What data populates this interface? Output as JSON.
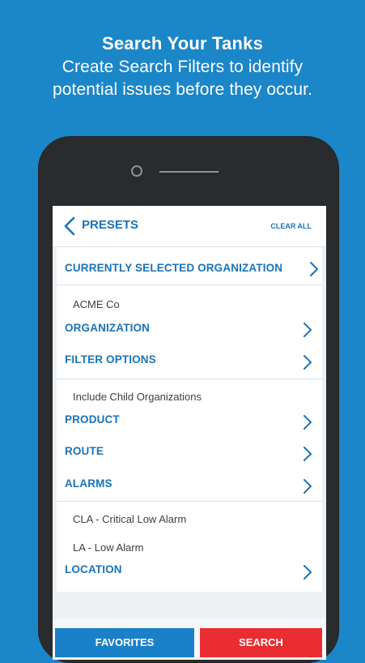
{
  "headline": {
    "title": "Search Your Tanks",
    "subtitle_line1": "Create Search Filters to identify",
    "subtitle_line2": "potential issues before they occur."
  },
  "screen": {
    "topbar": {
      "title": "PRESETS",
      "clear_all": "CLEAR ALL"
    },
    "sections": {
      "current_org_title": "CURRENTLY SELECTED ORGANIZATION",
      "current_org_value": "ACME Co",
      "organization": "ORGANIZATION",
      "filter_options": "FILTER OPTIONS",
      "filter_value": "Include Child Organizations",
      "product": "PRODUCT",
      "route": "ROUTE",
      "alarms": "ALARMS",
      "alarm_1": "CLA - Critical Low Alarm",
      "alarm_2": "LA - Low Alarm",
      "location": "LOCATION"
    },
    "buttons": {
      "favorites": "FAVORITES",
      "search": "SEARCH"
    }
  },
  "icons": {
    "back": "chevron-left-icon",
    "row": "chevron-right-icon"
  },
  "colors": {
    "background": "#1b86c8",
    "accent": "#1a73b8",
    "favorites": "#1a80c9",
    "search": "#e92d33",
    "phone": "#2a2b2d"
  }
}
